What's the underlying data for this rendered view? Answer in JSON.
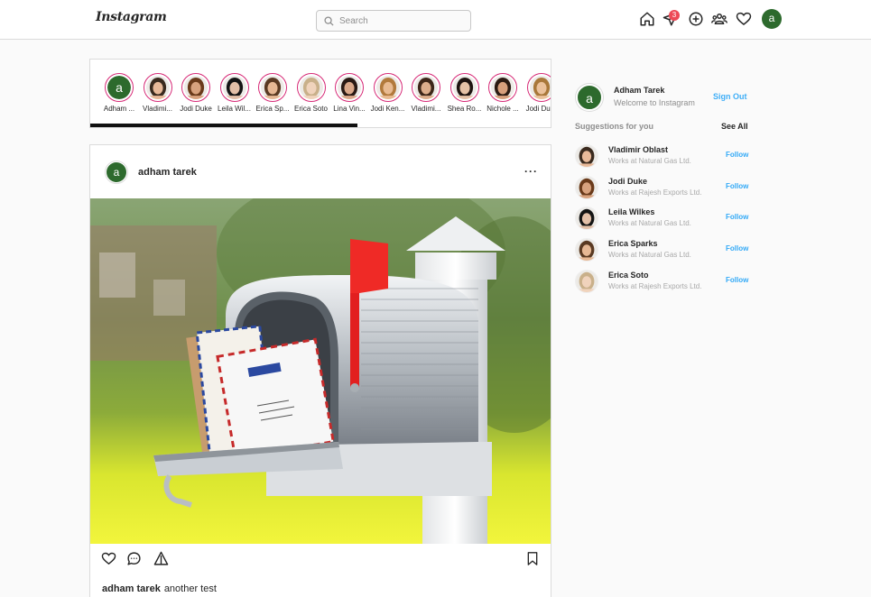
{
  "header": {
    "logo": "Instagram",
    "search_placeholder": "Search",
    "notification_count": "3",
    "avatar_letter": "a"
  },
  "stories": [
    {
      "name": "Adham ...",
      "letter": "a"
    },
    {
      "name": "Vladimi...",
      "skin": "#e8b999",
      "hair": "#3a2a1e"
    },
    {
      "name": "Jodi Duke",
      "skin": "#d8a27e",
      "hair": "#6a3a1a"
    },
    {
      "name": "Leila Wil...",
      "skin": "#e3c0a8",
      "hair": "#141414"
    },
    {
      "name": "Erica Sp...",
      "skin": "#e6b894",
      "hair": "#5a3a22"
    },
    {
      "name": "Erica Soto",
      "skin": "#f0d3bc",
      "hair": "#c9b08a"
    },
    {
      "name": "Lina Vin...",
      "skin": "#dba98a",
      "hair": "#2a1a14"
    },
    {
      "name": "Jodi Ken...",
      "skin": "#e9bb92",
      "hair": "#b27a3c"
    },
    {
      "name": "Vladimi...",
      "skin": "#dcae8c",
      "hair": "#3c2618"
    },
    {
      "name": "Shea Ro...",
      "skin": "#e5c2a6",
      "hair": "#1e1410"
    },
    {
      "name": "Nichole ...",
      "skin": "#d7a07c",
      "hair": "#2b1b12"
    },
    {
      "name": "Jodi Du...",
      "skin": "#ebc29c",
      "hair": "#a9783a"
    }
  ],
  "post": {
    "avatar_letter": "a",
    "username": "adham tarek",
    "more": "···",
    "caption_user": "adham tarek",
    "caption_text": "another test"
  },
  "sidebar": {
    "avatar_letter": "a",
    "name": "Adham Tarek",
    "subtitle": "Welcome to Instagram",
    "signout": "Sign Out",
    "suggestions_title": "Suggestions for you",
    "see_all": "See All",
    "follow_label": "Follow",
    "suggestions": [
      {
        "name": "Vladimir Oblast",
        "sub": "Works at Natural Gas Ltd.",
        "skin": "#e8b999",
        "hair": "#3a2a1e"
      },
      {
        "name": "Jodi Duke",
        "sub": "Works at Rajesh Exports Ltd.",
        "skin": "#d8a27e",
        "hair": "#6a3a1a"
      },
      {
        "name": "Leila Wilkes",
        "sub": "Works at Natural Gas Ltd.",
        "skin": "#e3c0a8",
        "hair": "#141414"
      },
      {
        "name": "Erica Sparks",
        "sub": "Works at Natural Gas Ltd.",
        "skin": "#e6b894",
        "hair": "#5a3a22"
      },
      {
        "name": "Erica Soto",
        "sub": "Works at Rajesh Exports Ltd.",
        "skin": "#f0d3bc",
        "hair": "#c9b08a"
      }
    ]
  }
}
